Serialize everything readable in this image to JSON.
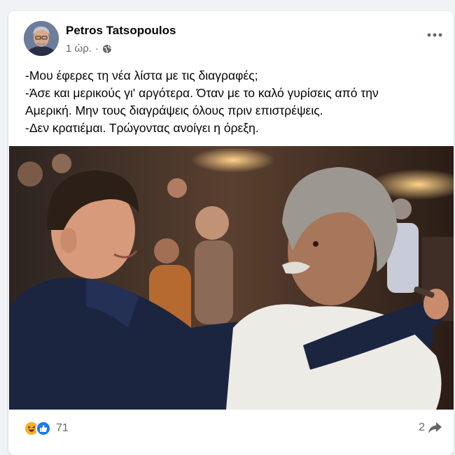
{
  "post": {
    "author": "Petros Tatsopoulos",
    "time": "1 ώρ.",
    "separator": "·",
    "privacy_icon": "globe-icon",
    "menu_icon": "more-horizontal-icon",
    "text_lines": [
      "-Μου έφερες τη νέα λίστα με τις διαγραφές;",
      "-Άσε και μερικούς γι' αργότερα. Όταν με το καλό γυρίσεις από την",
      "Αμερική. Μην τους διαγράψεις όλους πριν επιστρέψεις.",
      "-Δεν κρατιέμαι. Τρώγοντας ανοίγει η όρεξη."
    ]
  },
  "footer": {
    "reaction_icons": [
      "haha-icon",
      "like-icon"
    ],
    "reaction_count": "71",
    "share_count": "2",
    "share_icon": "share-arrow-icon"
  },
  "colors": {
    "background": "#f0f2f5",
    "card": "#ffffff",
    "text_primary": "#050505",
    "text_secondary": "#65676b",
    "like_blue": "#1877f2",
    "haha_yellow": "#f7b125"
  }
}
